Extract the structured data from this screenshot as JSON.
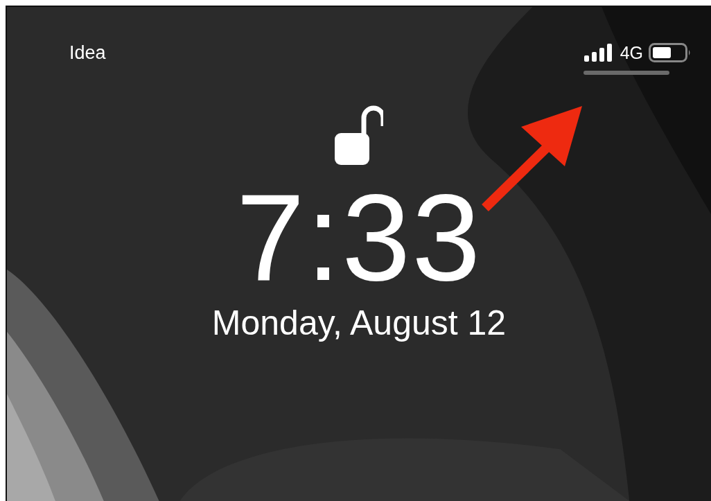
{
  "status_bar": {
    "carrier": "Idea",
    "network": "4G"
  },
  "lock": {
    "unlocked": true
  },
  "clock": {
    "time": "7:33",
    "date": "Monday, August 12"
  }
}
